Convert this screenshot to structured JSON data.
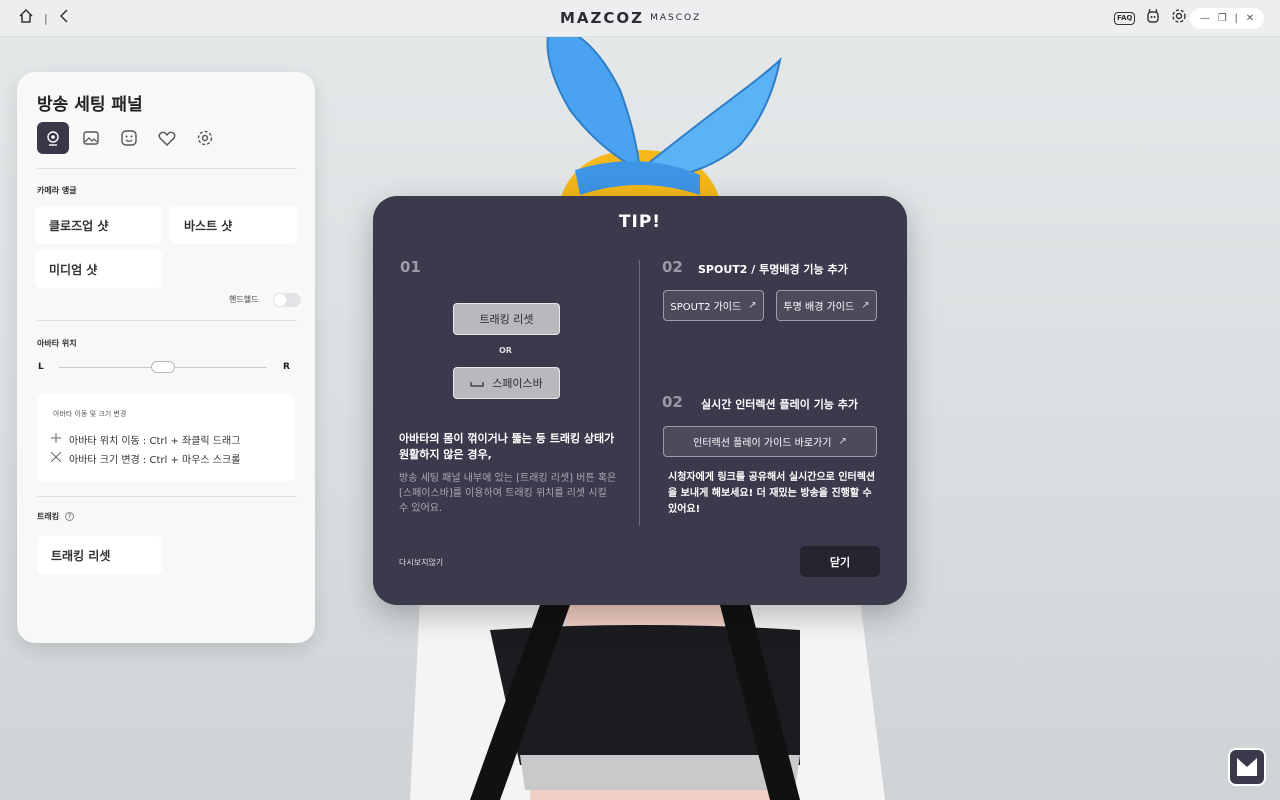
{
  "topbar": {
    "logo_mark": "MAZCOZ",
    "logo_text": "MASCOZ",
    "faq_label": "FAQ"
  },
  "panel": {
    "title": "방송 세팅 패널",
    "camera_angle_label": "카메라 앵글",
    "closeup_shot": "클로즈업 샷",
    "bust_shot": "바스트 샷",
    "medium_shot": "미디엄 샷",
    "handheld_label": "핸드헬드",
    "avatar_position_label": "아바타 위치",
    "slider_left": "L",
    "slider_right": "R",
    "move_resize_title": "아바타 이동 및 크기 변경",
    "move_instruction": "아바타 위치 이동 : Ctrl + 좌클릭 드래그",
    "resize_instruction": "아바타 크기 변경 : Ctrl + 마우스 스크롤",
    "tracking_label": "트래킹",
    "tracking_reset": "트래킹 리셋"
  },
  "tip_modal": {
    "title": "TIP!",
    "s1_number": "01",
    "tracking_reset_button": "트래킹 리셋",
    "or_label": "OR",
    "spacebar_button": "스페이스바",
    "bold_text": "아바타의 몸이 꺾이거나 뚫는 등 트래킹 상태가 원활하지 않은 경우,",
    "desc_text": "방송 세팅 패널 내부에 있는 [트래킹 리셋] 버튼 혹은 [스페이스바]를 이용하여 트래킹 위치를 리셋 시킬 수 있어요.",
    "s2_number": "02",
    "s2_title": "SPOUT2 / 투명배경 기능 추가",
    "spout2_guide": "SPOUT2 가이드",
    "transparent_guide": "투명 배경 가이드",
    "s3_number": "02",
    "s3_title": "실시간 인터렉션 플레이 기능 추가",
    "interaction_guide": "인터렉션 플레이 가이드 바로가기",
    "share_text": "시청자에게 링크를 공유해서 실시간으로 인터렉션을 보내게 해보세요! 더 재밌는 방송을 진행할 수 있어요!",
    "dont_show": "다시보지않기",
    "close": "닫기"
  },
  "colors": {
    "modal_bg": "#3a3a4c",
    "accent_active_tab": "#383848",
    "ribbon_blue": "#4aa3f0",
    "hair_yellow": "#f5b818"
  }
}
